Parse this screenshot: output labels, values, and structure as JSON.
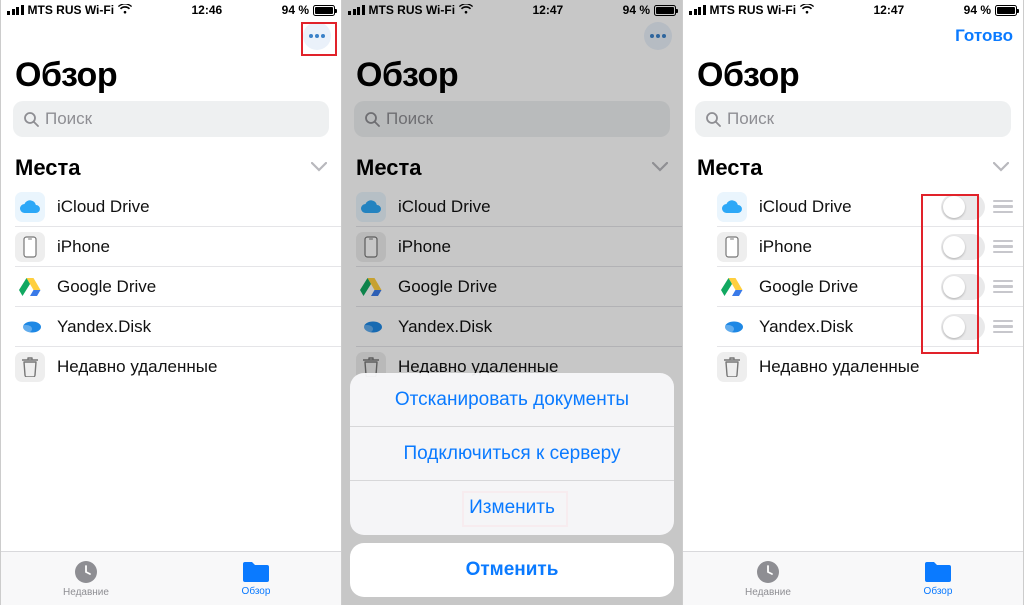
{
  "status": {
    "carrier": "MTS RUS Wi-Fi",
    "battery_pct": "94 %"
  },
  "screens": [
    {
      "time": "12:46",
      "nav": {
        "type": "more"
      }
    },
    {
      "time": "12:47",
      "nav": {
        "type": "more"
      }
    },
    {
      "time": "12:47",
      "nav": {
        "type": "done",
        "label": "Готово"
      }
    }
  ],
  "page_title": "Обзор",
  "search_placeholder": "Поиск",
  "section_label": "Места",
  "items": {
    "0": {
      "label": "iCloud Drive"
    },
    "1": {
      "label": "iPhone"
    },
    "2": {
      "label": "Google Drive"
    },
    "3": {
      "label": "Yandex.Disk"
    },
    "4": {
      "label": "Недавно удаленные"
    }
  },
  "actionsheet": {
    "scan": "Отсканировать документы",
    "connect": "Подключиться к серверу",
    "edit": "Изменить",
    "cancel": "Отменить"
  },
  "tabs": {
    "recent": "Недавние",
    "browse": "Обзор"
  }
}
